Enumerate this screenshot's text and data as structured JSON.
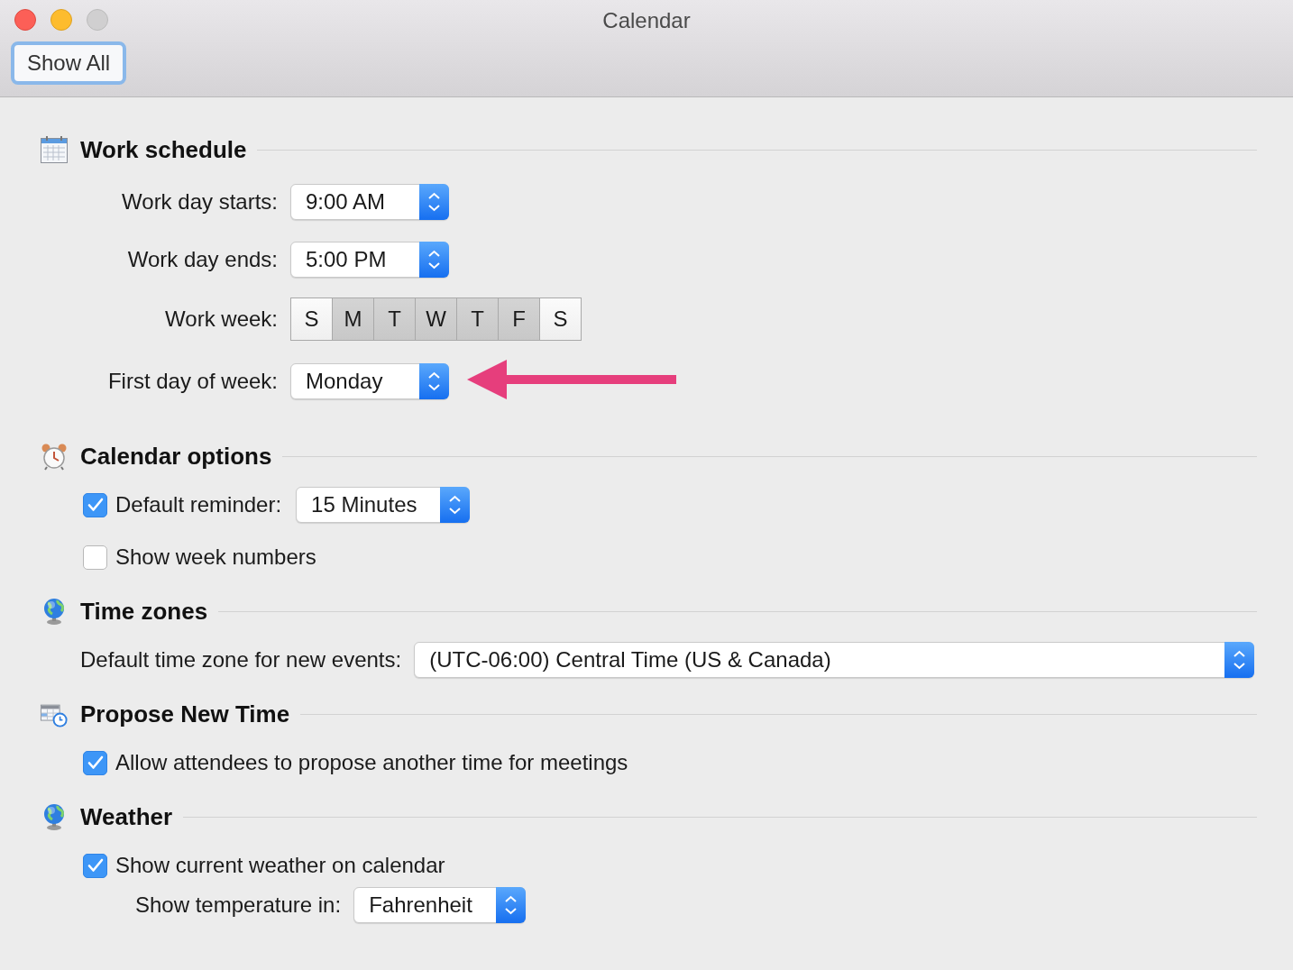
{
  "window": {
    "title": "Calendar"
  },
  "toolbar": {
    "button": "Show All"
  },
  "sections": [
    {
      "title": "Work schedule",
      "kind": "calendar",
      "rows": [
        {
          "kind": "aligned_popup",
          "label": "Work day starts:",
          "value": "9:00 AM"
        },
        {
          "kind": "aligned_popup",
          "label": "Work day ends:",
          "value": "5:00 PM"
        },
        {
          "kind": "weekdays",
          "label": "Work week:",
          "days": [
            {
              "label": "S",
              "selected": false
            },
            {
              "label": "M",
              "selected": true
            },
            {
              "label": "T",
              "selected": true
            },
            {
              "label": "W",
              "selected": true
            },
            {
              "label": "T",
              "selected": true
            },
            {
              "label": "F",
              "selected": true
            },
            {
              "label": "S",
              "selected": false
            }
          ]
        },
        {
          "kind": "aligned_popup",
          "label": "First day of week:",
          "value": "Monday",
          "pointer_arrow": true
        }
      ]
    },
    {
      "title": "Calendar options",
      "kind": "alarm_clock",
      "rows": [
        {
          "kind": "checkbox_popup",
          "label": "Default reminder:",
          "checked": true,
          "value": "15 Minutes"
        },
        {
          "kind": "checkbox",
          "label": "Show week numbers",
          "checked": false
        }
      ]
    },
    {
      "title": "Time zones",
      "kind": "globe",
      "rows": [
        {
          "kind": "wide_popup",
          "label": "Default time zone for new events:",
          "value": "(UTC-06:00) Central Time (US & Canada)"
        }
      ]
    },
    {
      "title": "Propose New Time",
      "kind": "calendar_clock",
      "rows": [
        {
          "kind": "checkbox",
          "label": "Allow attendees to propose another time for meetings",
          "checked": true
        }
      ]
    },
    {
      "title": "Weather",
      "kind": "globe",
      "rows": [
        {
          "kind": "checkbox",
          "label": "Show current weather on calendar",
          "checked": true
        },
        {
          "kind": "sub_popup",
          "label": "Show temperature in:",
          "value": "Fahrenheit"
        }
      ]
    }
  ]
}
